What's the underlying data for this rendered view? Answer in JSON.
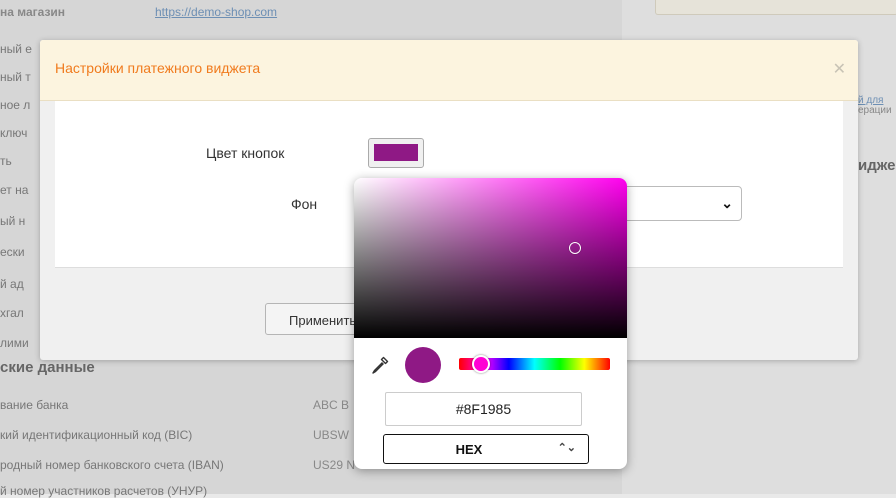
{
  "background_page": {
    "store_link_label": "на магазин",
    "store_link": "https://demo-shop.com",
    "left_fragments": [
      "ный е",
      "ный т",
      "ное л",
      "ключ",
      "ть",
      "ет на",
      "ый н",
      "ески",
      "й ад",
      "хгал",
      "лими"
    ],
    "bank_section_title": "ские данные",
    "bank_rows": [
      {
        "label": "вание банка",
        "value": "ABC B"
      },
      {
        "label": "кий идентификационный код (BIC)",
        "value": "UBSW"
      },
      {
        "label": "родный номер банковского счета (IBAN)",
        "value": "US29 N"
      },
      {
        "label": "й номер участников расчетов (УНУР)",
        "value": ""
      }
    ],
    "right_link_text": "й для",
    "right_small_text": "ерации",
    "right_heading": "идже"
  },
  "modal": {
    "title": "Настройки платежного виджета",
    "close_icon": "close-icon",
    "button_color_label": "Цвет кнопок",
    "background_label": "Фон",
    "apply_label": "Применить"
  },
  "color_picker": {
    "hex_value": "#8F1985",
    "format_label": "HEX",
    "selected_color": "#8F1985",
    "hue_color": "#ff00d4",
    "icons": [
      "eyedropper-icon",
      "chevron-down-icon",
      "updown-arrow-icon"
    ]
  }
}
